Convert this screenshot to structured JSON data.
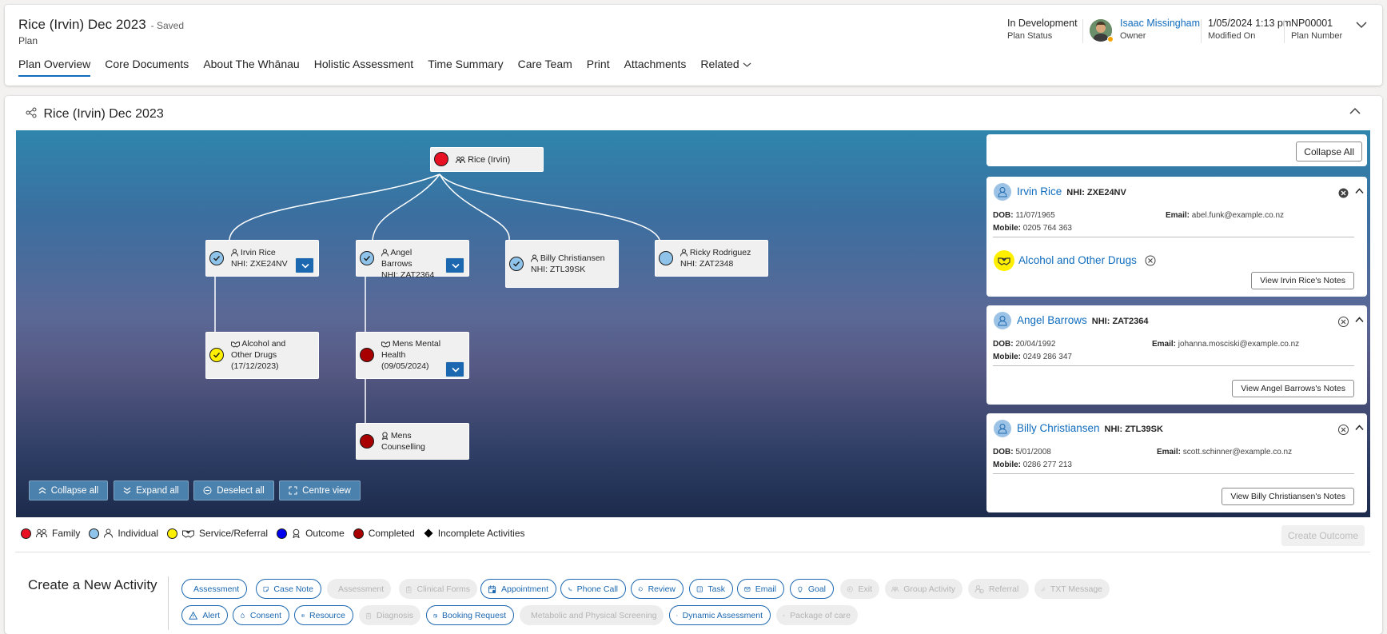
{
  "header": {
    "title": "Rice (Irvin) Dec 2023",
    "saved": "- Saved",
    "subtitle": "Plan",
    "fields": {
      "status": {
        "value": "In Development",
        "label": "Plan Status"
      },
      "owner": {
        "value": "Isaac Missingham",
        "label": "Owner"
      },
      "modified": {
        "value": "1/05/2024 1:13 pm",
        "label": "Modified On"
      },
      "number": {
        "value": "NP00001",
        "label": "Plan Number"
      }
    },
    "tabs": [
      "Plan Overview",
      "Core Documents",
      "About The Whānau",
      "Holistic Assessment",
      "Time Summary",
      "Care Team",
      "Print",
      "Attachments",
      "Related"
    ]
  },
  "section": {
    "title": "Rice (Irvin) Dec 2023"
  },
  "tree": {
    "root": {
      "label": "Rice (Irvin)",
      "status": "Family"
    },
    "nodes": [
      {
        "name": "Irvin Rice",
        "nhi": "NHI: ZXE24NV"
      },
      {
        "name": "Angel Barrows",
        "nhi": "NHI: ZAT2364"
      },
      {
        "name": "Billy Christiansen",
        "nhi": "NHI: ZTL39SK"
      },
      {
        "name": "Ricky Rodriguez",
        "nhi": "NHI: ZAT2348"
      }
    ],
    "services": [
      {
        "line1": "Alcohol and",
        "line2": "Other Drugs",
        "date": "(17/12/2023)"
      },
      {
        "line1": "Mens Mental",
        "line2": "Health",
        "date": "(09/05/2024)"
      },
      {
        "line1": "Mens",
        "line2": "Counselling"
      }
    ],
    "buttons": [
      "Collapse all",
      "Expand all",
      "Deselect all",
      "Centre view"
    ]
  },
  "panel": {
    "collapse_all": "Collapse All",
    "people": [
      {
        "name": "Irvin Rice",
        "nhi": "NHI: ZXE24NV",
        "dob_label": "DOB:",
        "dob": "11/07/1965",
        "email_label": "Email:",
        "email": "abel.funk@example.co.nz",
        "mobile_label": "Mobile:",
        "mobile": "0205 764 363",
        "service": "Alcohol and Other Drugs",
        "notes": "View Irvin Rice's Notes"
      },
      {
        "name": "Angel Barrows",
        "nhi": "NHI: ZAT2364",
        "dob_label": "DOB:",
        "dob": "20/04/1992",
        "email_label": "Email:",
        "email": "johanna.mosciski@example.co.nz",
        "mobile_label": "Mobile:",
        "mobile": "0249 286 347",
        "notes": "View Angel Barrows's Notes"
      },
      {
        "name": "Billy Christiansen",
        "nhi": "NHI: ZTL39SK",
        "dob_label": "DOB:",
        "dob": "5/01/2008",
        "email_label": "Email:",
        "email": "scott.schinner@example.co.nz",
        "mobile_label": "Mobile:",
        "mobile": "0286 277 213",
        "notes": "View Billy Christiansen's Notes"
      }
    ]
  },
  "legend": [
    "Family",
    "Individual",
    "Service/Referral",
    "Outcome",
    "Completed",
    "Incomplete Activities"
  ],
  "legend_colors": {
    "family": "#e81123",
    "individual": "#8fc3ea",
    "service": "#ffef00",
    "outcome": "#0000ee",
    "completed": "#a80000",
    "incomplete": "#000000"
  },
  "create_outcome": "Create Outcome",
  "activity": {
    "title": "Create a New Activity",
    "row1": [
      "Assessment",
      "Case Note",
      "Assessment",
      "Clinical Forms",
      "Appointment",
      "Phone Call",
      "Review",
      "Task",
      "Email",
      "Goal",
      "Exit",
      "Group Activity",
      "Referral",
      "TXT Message"
    ],
    "row2": [
      "Alert",
      "Consent",
      "Resource",
      "Diagnosis",
      "Booking Request",
      "Metabolic and Physical Screening",
      "Dynamic Assessment",
      "Package of care"
    ]
  }
}
